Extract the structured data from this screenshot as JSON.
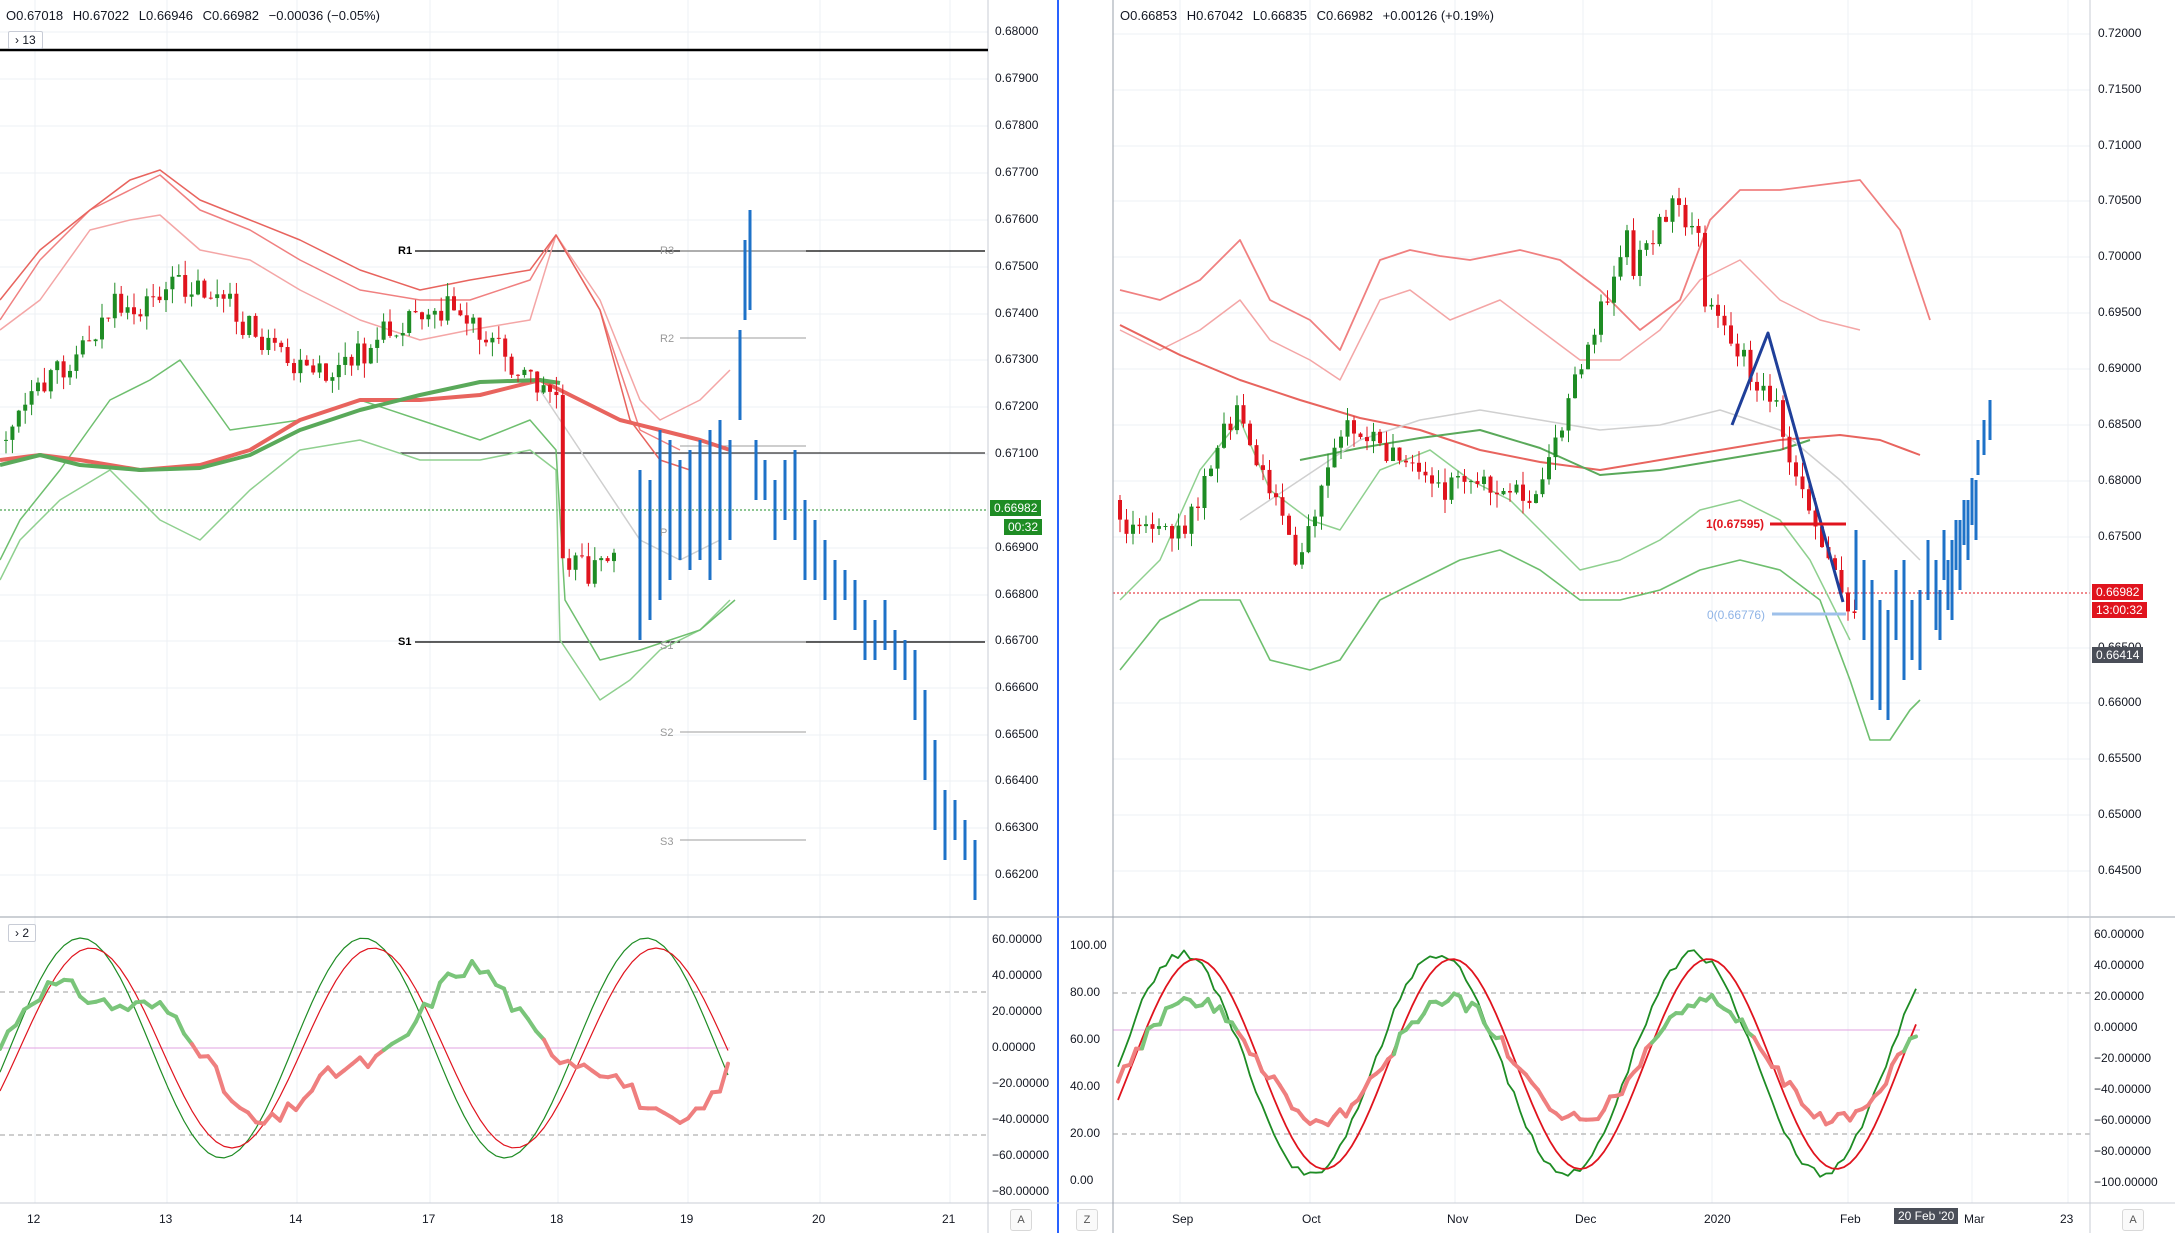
{
  "left_panel": {
    "ohlc": {
      "o": "O0.67018",
      "h": "H0.67022",
      "l": "L0.66946",
      "c": "C0.66982",
      "chg": "−0.00036 (−0.05%)"
    },
    "main_collapse": "13",
    "sub_collapse": "2",
    "price_axis": [
      "0.68000",
      "0.67900",
      "0.67800",
      "0.67700",
      "0.67600",
      "0.67500",
      "0.67400",
      "0.67300",
      "0.67200",
      "0.67100",
      "0.66900",
      "0.66800",
      "0.66700",
      "0.66600",
      "0.66500",
      "0.66400",
      "0.66300",
      "0.66200"
    ],
    "price_tag": "0.66982",
    "countdown": "00:32",
    "osc_axis": [
      "60.00000",
      "40.00000",
      "20.00000",
      "0.00000",
      "−20.00000",
      "−40.00000",
      "−60.00000",
      "−80.00000"
    ],
    "time_axis": [
      "12",
      "13",
      "14",
      "17",
      "18",
      "19",
      "20",
      "21"
    ],
    "pivots": {
      "r1": "R1",
      "s1": "S1",
      "r3": "R3",
      "r2": "R2",
      "p": "P",
      "s1b": "S1",
      "s2": "S2",
      "s3": "S3"
    },
    "auto_btn": "A"
  },
  "right_panel": {
    "ohlc": {
      "o": "O0.66853",
      "h": "H0.67042",
      "l": "L0.66835",
      "c": "C0.66982",
      "chg": "+0.00126 (+0.19%)"
    },
    "price_axis": [
      "0.72000",
      "0.71500",
      "0.71000",
      "0.70500",
      "0.70000",
      "0.69500",
      "0.69000",
      "0.68500",
      "0.68000",
      "0.67500",
      "0.66500",
      "0.66000",
      "0.65500",
      "0.65000",
      "0.64500"
    ],
    "price_tag": "0.66982",
    "countdown": "13:00:32",
    "low_tag": "0.66414",
    "fib1": "1(0.67595)",
    "fib0": "0(0.66776)",
    "osc_left_axis": [
      "100.00",
      "80.00",
      "60.00",
      "40.00",
      "20.00",
      "0.00"
    ],
    "osc_axis": [
      "60.00000",
      "40.00000",
      "20.00000",
      "0.00000",
      "−20.00000",
      "−40.00000",
      "−60.00000",
      "−80.00000",
      "−100.00000"
    ],
    "time_axis": [
      "Sep",
      "Oct",
      "Nov",
      "Dec",
      "2020",
      "Feb",
      "Mar",
      "23"
    ],
    "date_tag": "20 Feb '20",
    "zoom_btn": "Z",
    "auto_btn": "A"
  },
  "colors": {
    "up": "#1e8c24",
    "down": "#e0141e",
    "blue": "#1e72c8",
    "red_band": "#f08080",
    "green_band": "#6fbf6f"
  }
}
